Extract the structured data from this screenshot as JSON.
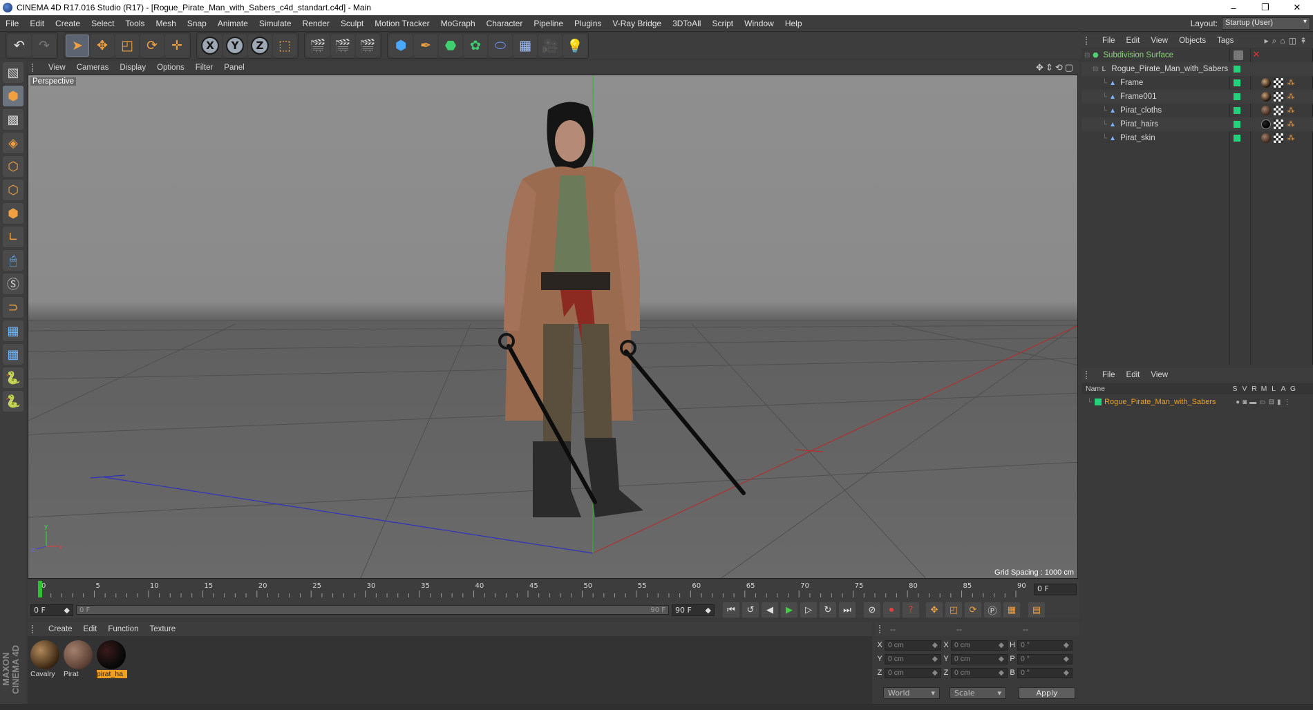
{
  "window": {
    "title": "CINEMA 4D R17.016 Studio (R17) - [Rogue_Pirate_Man_with_Sabers_c4d_standart.c4d] - Main",
    "minimize": "–",
    "restore": "❐",
    "close": "✕"
  },
  "menu": {
    "items": [
      "File",
      "Edit",
      "Create",
      "Select",
      "Tools",
      "Mesh",
      "Snap",
      "Animate",
      "Simulate",
      "Render",
      "Sculpt",
      "Motion Tracker",
      "MoGraph",
      "Character",
      "Pipeline",
      "Plugins",
      "V-Ray Bridge",
      "3DToAll",
      "Script",
      "Window",
      "Help"
    ],
    "layout_label": "Layout:",
    "layout_value": "Startup (User)"
  },
  "toolbar": {
    "undo_icon": "undo-icon",
    "redo_icon": "redo-icon",
    "axes": [
      "X",
      "Y",
      "Z"
    ]
  },
  "viewport": {
    "menu": [
      "View",
      "Cameras",
      "Display",
      "Options",
      "Filter",
      "Panel"
    ],
    "label": "Perspective",
    "grid_spacing": "Grid Spacing : 1000 cm",
    "axis_y": "y",
    "axis_x": "x",
    "axis_z": "z"
  },
  "timeline": {
    "ticks": [
      "0",
      "5",
      "10",
      "15",
      "20",
      "25",
      "30",
      "35",
      "40",
      "45",
      "50",
      "55",
      "60",
      "65",
      "70",
      "75",
      "80",
      "85",
      "90"
    ],
    "current_frame": "0 F",
    "start_field": "0 F",
    "slider_start": "0 F",
    "slider_end": "90 F",
    "end_field": "90 F"
  },
  "materials": {
    "menu": [
      "Create",
      "Edit",
      "Function",
      "Texture"
    ],
    "items": [
      {
        "name": "Cavalry",
        "selected": false
      },
      {
        "name": "Pirat",
        "selected": false
      },
      {
        "name": "pirat_ha",
        "selected": true
      }
    ]
  },
  "coordinates": {
    "header": [
      "--",
      "--",
      "--"
    ],
    "rows": [
      {
        "a": "X",
        "av": "0 cm",
        "b": "X",
        "bv": "0 cm",
        "c": "H",
        "cv": "0 °"
      },
      {
        "a": "Y",
        "av": "0 cm",
        "b": "Y",
        "bv": "0 cm",
        "c": "P",
        "cv": "0 °"
      },
      {
        "a": "Z",
        "av": "0 cm",
        "b": "Z",
        "bv": "0 cm",
        "c": "B",
        "cv": "0 °"
      }
    ],
    "world": "World",
    "scale": "Scale",
    "apply": "Apply"
  },
  "objects_panel": {
    "menu": [
      "File",
      "Edit",
      "View",
      "Objects",
      "Tags"
    ],
    "rows": [
      {
        "name": "Subdivision Surface",
        "type": "subdivision"
      },
      {
        "name": "Rogue_Pirate_Man_with_Sabers",
        "type": "null"
      },
      {
        "name": "Frame",
        "type": "polygon"
      },
      {
        "name": "Frame001",
        "type": "polygon"
      },
      {
        "name": "Pirat_cloths",
        "type": "polygon"
      },
      {
        "name": "Pirat_hairs",
        "type": "polygon"
      },
      {
        "name": "Pirat_skin",
        "type": "polygon"
      }
    ],
    "status_color": "#23d27a"
  },
  "attributes_panel": {
    "menu": [
      "File",
      "Edit",
      "View"
    ],
    "columns": [
      "Name",
      "S",
      "V",
      "R",
      "M",
      "L",
      "A",
      "G"
    ],
    "rows": [
      {
        "name": "Rogue_Pirate_Man_with_Sabers"
      }
    ]
  },
  "colors": {
    "accent": "#f0a020",
    "selection_green": "#23d27a"
  }
}
